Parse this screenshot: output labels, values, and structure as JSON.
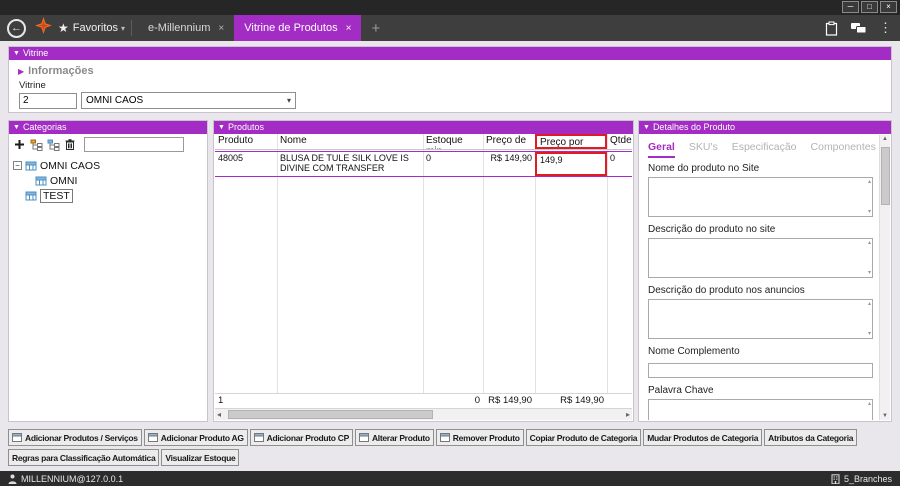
{
  "colors": {
    "accent": "#A32CC4",
    "highlight_red": "#E01B24",
    "logo_orange": "#F26A21"
  },
  "window": {
    "minimize": "─",
    "maximize": "□",
    "close": "×"
  },
  "tabbar": {
    "back_icon": "←",
    "favorites_star": "★",
    "favorites_label": "Favoritos",
    "favorites_caret": "▾",
    "tabs": [
      {
        "label": "e-Millennium",
        "close": "×",
        "active": false
      },
      {
        "label": "Vitrine de Produtos",
        "close": "×",
        "active": true
      }
    ],
    "new_tab": "+",
    "menu_dots": "⋮"
  },
  "vitrine": {
    "header": "Vitrine",
    "collapse_icon": "▼",
    "info_icon": "▶",
    "informacoes": "Informações",
    "field_label": "Vitrine",
    "code_value": "2",
    "selected_option": "OMNI CAOS",
    "select_chevron": "▾"
  },
  "categorias": {
    "header": "Categorias",
    "collapse_icon": "▼",
    "search_value": "",
    "tree": {
      "root_expander": "−",
      "root": "OMNI CAOS",
      "child": "OMNI",
      "sibling": "TEST"
    }
  },
  "produtos": {
    "header": "Produtos",
    "collapse_icon": "▼",
    "columns": [
      "Produto",
      "Nome",
      "Estoque min",
      "Preço de",
      "Preço por",
      "Qtde ..."
    ],
    "row": {
      "produto": "48005",
      "nome": "BLUSA DE TULE SILK LOVE IS DIVINE COM TRANSFER",
      "estoque_min": "0",
      "preco_de": "R$ 149,90",
      "preco_por": "149,9",
      "qtde": "0"
    },
    "summary": {
      "count": "1",
      "estoque": "0",
      "preco_de": "R$ 149,90",
      "preco_por": "R$ 149,90"
    },
    "hscroll": {
      "left_arrow": "◂",
      "right_arrow": "▸"
    }
  },
  "detalhes": {
    "header": "Detalhes do Produto",
    "collapse_icon": "▼",
    "tabs": [
      "Geral",
      "SKU's",
      "Especificação",
      "Componentes"
    ],
    "active_tab": "Geral",
    "labels": {
      "nome_site": "Nome do produto no Site",
      "descricao_site": "Descrição do produto no site",
      "descricao_anuncios": "Descrição do produto nos anuncios",
      "nome_complemento": "Nome Complemento",
      "palavra_chave": "Palavra Chave"
    },
    "mini_scroll": {
      "up": "▴",
      "down": "▾"
    },
    "vscroll": {
      "up_arrow": "▲",
      "down_arrow": "▼"
    }
  },
  "actions": {
    "row1": [
      "Adicionar Produtos / Serviços",
      "Adicionar Produto AG",
      "Adicionar Produto CP",
      "Alterar Produto",
      "Remover Produto",
      "Copiar Produto de Categoria",
      "Mudar Produtos de Categoria",
      "Atributos da Categoria"
    ],
    "row2": [
      "Regras para Classificação Automática",
      "Visualizar Estoque"
    ]
  },
  "statusbar": {
    "user": "MILLENNIUM@127.0.0.1",
    "branches": "5_Branches"
  }
}
